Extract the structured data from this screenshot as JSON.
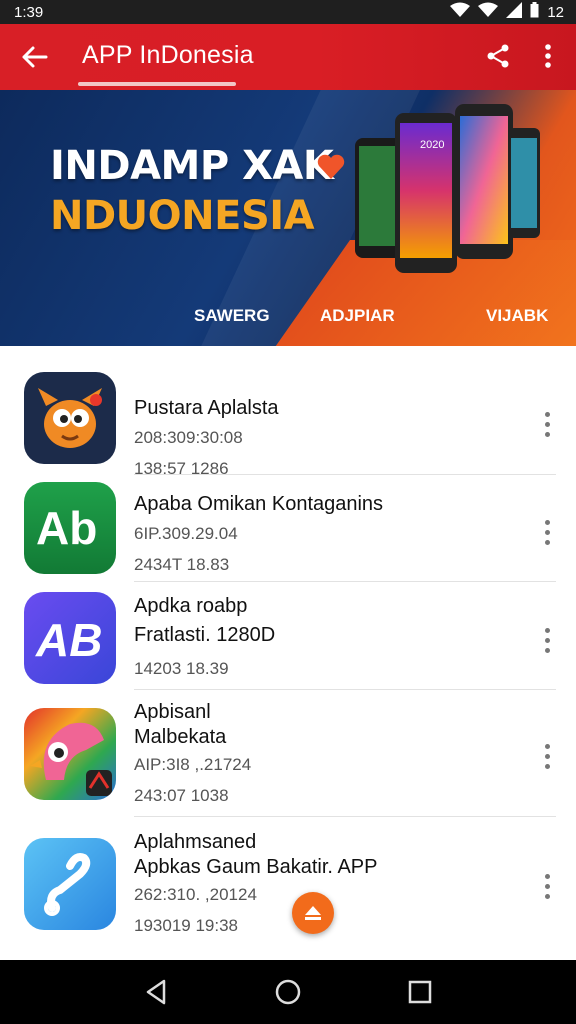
{
  "status_bar": {
    "time": "1:39",
    "battery": "12"
  },
  "app_bar": {
    "title": "APP InDonesia"
  },
  "banner": {
    "headline_line1": "INDAMP XAK",
    "headline_line2": "NDUONESIA",
    "labels": [
      "SAWERG",
      "ADJPIAR",
      "VIJABK"
    ],
    "phone_screen_text": "2020"
  },
  "apps": [
    {
      "name": "Pustara Aplalsta",
      "line2": "208:309:30:08",
      "meta": "138:57    1286"
    },
    {
      "name": "Apaba Omikan Kontaganins",
      "line2": "6IP.309.29.04",
      "meta": "2434T    18.83"
    },
    {
      "name": "Apdka roabp",
      "line2": "Fratlasti. 1280D",
      "meta": "14203    18.39"
    },
    {
      "name": "Apbisanl",
      "line2": "Malbekata",
      "line3": "AIP:3I8 ,.21724",
      "meta": "243:07    1038"
    },
    {
      "name": "Aplahmsaned",
      "line2": "Apbkas Gaum Bakatir. APP",
      "line3": "262:310. ,20124",
      "meta": "193019    19:38"
    }
  ],
  "icons": {
    "app1": "cartoon-creature-icon",
    "app2": "ab-green-icon",
    "app3": "ab-blue-icon",
    "app4": "parrot-icon",
    "app5": "swirl-blue-icon"
  },
  "colors": {
    "app_bar": "#d81f26",
    "banner_blue": "#143a78",
    "banner_orange": "#f26b1b",
    "accent_gold": "#f5a623"
  }
}
